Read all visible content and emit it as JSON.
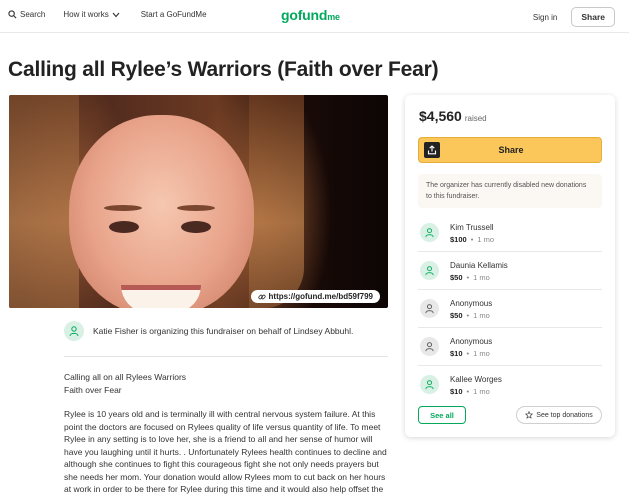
{
  "header": {
    "search_label": "Search",
    "how_it_works_label": "How it works",
    "start_label": "Start a GoFundMe",
    "logo_main": "gofund",
    "logo_me": "me",
    "signin_label": "Sign in",
    "share_label": "Share"
  },
  "campaign": {
    "title": "Calling all Rylee’s Warriors (Faith over Fear)",
    "short_link": "https://gofund.me/bd59f799",
    "organizer_text": "Katie Fisher is organizing this fundraiser on behalf of Lindsey Abbuhl.",
    "story_heading_line1": "Calling all on all Rylees Warriors",
    "story_heading_line2": "Faith over Fear",
    "story_body": "Rylee is 10 years old and is terminally ill with central nervous system failure. At this point the doctors are focused on Rylees quality of life versus quantity of life. To meet Rylee in any setting is to love her, she is a friend to all and her sense of humor will have you laughing until it hurts. . Unfortunately Rylees health continues to decline and although she continues to fight this courageous fight she not only needs prayers but she needs her mom. Your donation would allow Rylees mom to cut back on her hours at work in order to be there for Rylee during this time and it would also help offset the"
  },
  "sidebar": {
    "amount": "$4,560",
    "raised_label": "raised",
    "share_label": "Share",
    "notice": "The organizer has currently disabled new donations to this fundraiser.",
    "donations": [
      {
        "name": "Kim Trussell",
        "amount": "$100",
        "time": "1 mo",
        "avatar": "green"
      },
      {
        "name": "Daunia Kellamis",
        "amount": "$50",
        "time": "1 mo",
        "avatar": "green"
      },
      {
        "name": "Anonymous",
        "amount": "$50",
        "time": "1 mo",
        "avatar": "gray"
      },
      {
        "name": "Anonymous",
        "amount": "$10",
        "time": "1 mo",
        "avatar": "gray"
      },
      {
        "name": "Kallee Worges",
        "amount": "$10",
        "time": "1 mo",
        "avatar": "green"
      }
    ],
    "see_all_label": "See all",
    "see_top_label": "See top donations"
  },
  "colors": {
    "brand_green": "#02a95c",
    "share_yellow": "#fbc75b"
  },
  "icons": [
    "search-icon",
    "chevron-down-icon",
    "link-icon",
    "user-heart-icon",
    "share-arrow-icon",
    "star-icon"
  ]
}
